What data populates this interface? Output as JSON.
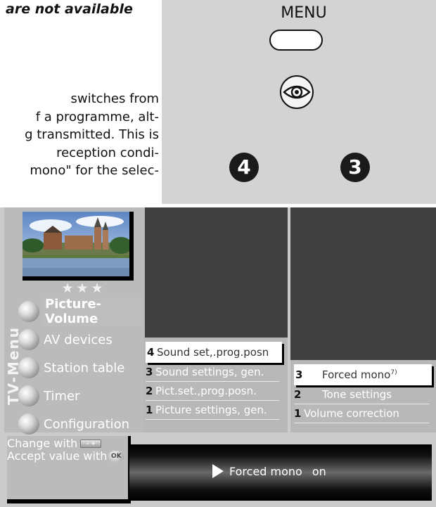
{
  "doc": {
    "heading": "are not available",
    "body_lines": [
      "switches from",
      "f a programme, alt-",
      "g transmitted. This is",
      "reception condi-",
      "mono\" for the selec-"
    ]
  },
  "remote": {
    "menu_label": "MENU",
    "step_badges": [
      "4",
      "3"
    ]
  },
  "osd": {
    "stars": "★★★",
    "sidebar_title": "TV-Menu",
    "menu_items": [
      {
        "label": "Picture-Volume",
        "active": true
      },
      {
        "label": "AV devices",
        "active": false
      },
      {
        "label": "Station table",
        "active": false
      },
      {
        "label": "Timer",
        "active": false
      },
      {
        "label": "Configuration",
        "active": false
      }
    ],
    "panel_a_items": [
      {
        "num": "4",
        "label": "Sound set,.prog.posn",
        "selected": true
      },
      {
        "num": "3",
        "label": "Sound settings, gen.",
        "selected": false
      },
      {
        "num": "2",
        "label": "Pict.set.,prog.posn.",
        "selected": false
      },
      {
        "num": "1",
        "label": "Picture settings, gen.",
        "selected": false
      }
    ],
    "panel_b_items": [
      {
        "num": "3",
        "label": "Forced mono",
        "sup": "7)",
        "selected": true
      },
      {
        "num": "2",
        "label": "Tone settings",
        "selected": false
      },
      {
        "num": "1",
        "label": "Volume correction",
        "selected": false
      }
    ],
    "help": {
      "change_with": "Change with",
      "minus_plus": "– +",
      "accept_with": "Accept value with",
      "ok": "OK"
    },
    "status": {
      "label": "Forced mono",
      "value": "on"
    }
  },
  "colors": {
    "osd_background": "#cbcbcb",
    "panel_gray": "#b8b8b8",
    "video_dark": "#404040",
    "remote_background": "#d3d3d3"
  }
}
